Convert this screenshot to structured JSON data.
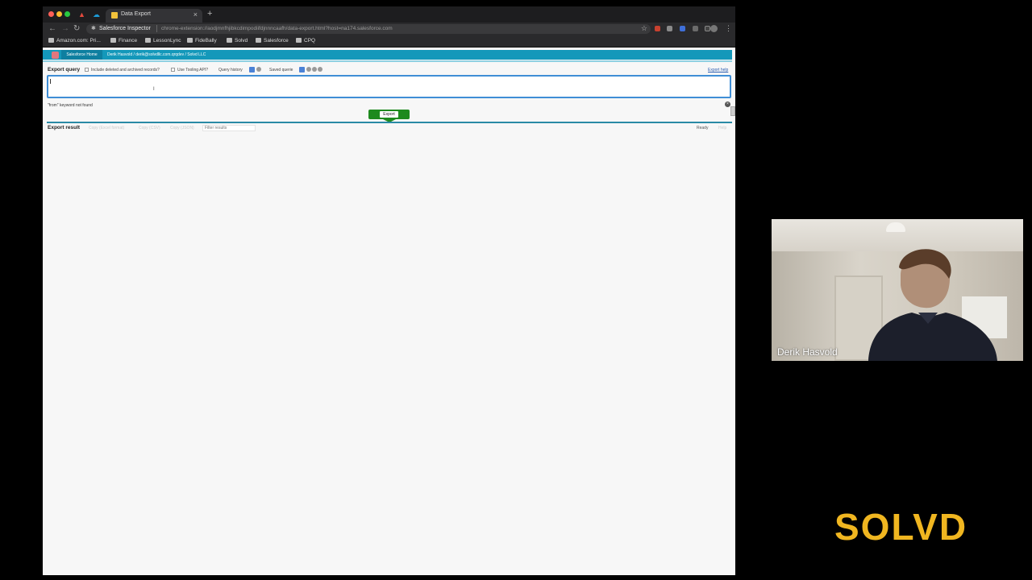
{
  "browser": {
    "tab_title": "Data Export",
    "tab_close": "×",
    "new_tab": "+",
    "site_name": "Salesforce Inspector",
    "url": "chrome-extension://aodjmnfhjibkcdimpodiifdjnnncaafh/data-export.html?host=na174.salesforce.com",
    "star": "☆",
    "menu": "⋮",
    "nav": {
      "back": "←",
      "forward": "→",
      "reload": "↻"
    }
  },
  "bookmarks": [
    "Amazon.com: Pri...",
    "Finance",
    "LessonLync",
    "FideBally",
    "Solvd",
    "Salesforce",
    "CPQ"
  ],
  "sf_header": {
    "home_label": "Salesforce Home",
    "user_info": "Derik Hasvold / derik@solvdllc.com.qrqdev / Solvd LLC"
  },
  "query_bar": {
    "title": "Export query",
    "include_deleted_label": "Include deleted and archived records?",
    "use_tooling_label": "Use Tooling API?",
    "query_history_label": "Query history",
    "saved_queries_label": "Saved querie",
    "export_help": "Export help"
  },
  "editor": {
    "message": "\"from\" keyword not found"
  },
  "export_button_label": "Export",
  "result_bar": {
    "title": "Export result",
    "copy_excel": "Copy (Excel format)",
    "copy_csv": "Copy (CSV)",
    "copy_json": "Copy (JSON)",
    "filter_placeholder": "Filter results",
    "status": "Ready",
    "help": "Help"
  },
  "webcam": {
    "name_label": "Derik Hasvold"
  },
  "brand": "SOLVD"
}
